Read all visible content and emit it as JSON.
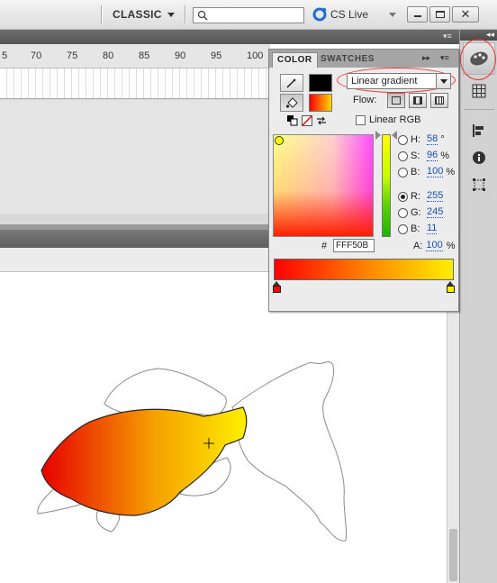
{
  "topbar": {
    "workspace_label": "CLASSIC",
    "search_placeholder": "",
    "cslive_label": "CS Live"
  },
  "timeline": {
    "ruler_numbers": [
      "5",
      "70",
      "75",
      "80",
      "85",
      "90",
      "95",
      "100"
    ]
  },
  "color_panel": {
    "tabs": {
      "color": "COLOR",
      "swatches": "SWATCHES"
    },
    "type_select": "Linear gradient",
    "flow_label": "Flow:",
    "linear_rgb_label": "Linear RGB",
    "params": {
      "h": {
        "label": "H:",
        "value": "58",
        "unit": "°"
      },
      "s": {
        "label": "S:",
        "value": "96",
        "unit": "%"
      },
      "b": {
        "label": "B:",
        "value": "100",
        "unit": "%"
      },
      "r": {
        "label": "R:",
        "value": "255",
        "unit": ""
      },
      "g": {
        "label": "G:",
        "value": "245",
        "unit": ""
      },
      "b2": {
        "label": "B:",
        "value": "11",
        "unit": ""
      }
    },
    "hex_label": "#",
    "hex_value": "FFF50B",
    "alpha_label": "A:",
    "alpha_value": "100",
    "alpha_unit": "%",
    "stroke_color": "#000000",
    "gradient_stops": [
      {
        "color": "#ff0000",
        "position": 0
      },
      {
        "color": "#ffee00",
        "position": 1
      }
    ]
  }
}
